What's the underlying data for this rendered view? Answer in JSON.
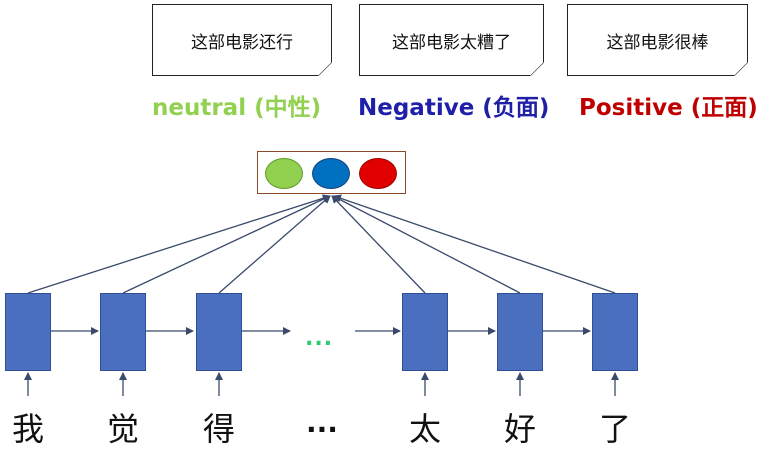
{
  "reviews": [
    {
      "text": "这部电影还行"
    },
    {
      "text": "这部电影太糟了"
    },
    {
      "text": "这部电影很棒"
    }
  ],
  "sentiments": [
    {
      "label": "neutral (中性)",
      "color": "#92d050"
    },
    {
      "label": "Negative (负面)",
      "color": "#1f1fa8"
    },
    {
      "label": "Positive (正面)",
      "color": "#c00000"
    }
  ],
  "output_circles": [
    {
      "color": "#92d050"
    },
    {
      "color": "#0070c0"
    },
    {
      "color": "#e00000"
    }
  ],
  "rnn": {
    "cell_color": "#4a6fbe",
    "middle_ellipsis": "...",
    "tokens": [
      "我",
      "觉",
      "得",
      "...",
      "太",
      "好",
      "了"
    ]
  }
}
